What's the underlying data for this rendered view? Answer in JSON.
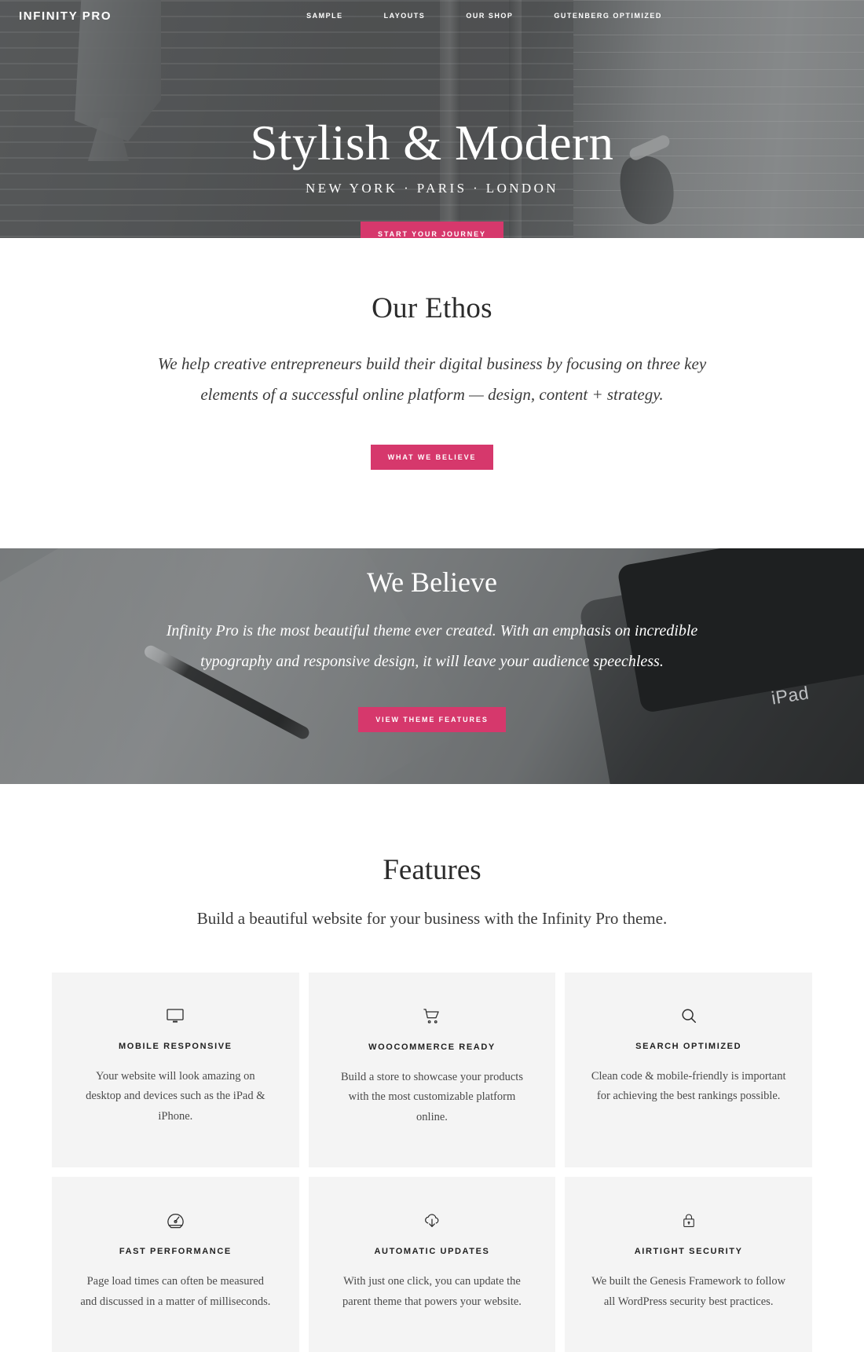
{
  "colors": {
    "accent": "#d6386c",
    "card_bg": "#f4f4f4",
    "hero_overlay": "#5f6163",
    "text_dark": "#2b2b2b"
  },
  "header": {
    "site_title": "INFINITY PRO",
    "nav": [
      {
        "label": "SAMPLE"
      },
      {
        "label": "LAYOUTS"
      },
      {
        "label": "OUR SHOP"
      },
      {
        "label": "GUTENBERG OPTIMIZED"
      }
    ]
  },
  "hero": {
    "title": "Stylish & Modern",
    "subtitle": "NEW YORK · PARIS · LONDON",
    "cta_label": "START YOUR JOURNEY"
  },
  "ethos": {
    "title": "Our Ethos",
    "text": "We help creative entrepreneurs build their digital business by focusing on three key elements of a successful online platform — design, content + strategy.",
    "cta_label": "WHAT WE BELIEVE"
  },
  "believe": {
    "title": "We Believe",
    "text": "Infinity Pro is the most beautiful theme ever created. With an emphasis on incredible typography and responsive design, it will leave your audience speechless.",
    "cta_label": "VIEW THEME FEATURES",
    "device_label": "iPad"
  },
  "features": {
    "title": "Features",
    "subtitle": "Build a beautiful website for your business with the Infinity Pro theme.",
    "cards": [
      {
        "icon": "monitor-icon",
        "title": "MOBILE RESPONSIVE",
        "text": "Your website will look amazing on desktop and devices such as the iPad & iPhone."
      },
      {
        "icon": "shopping-cart-icon",
        "title": "WOOCOMMERCE READY",
        "text": "Build a store to showcase your products with the most customizable platform online."
      },
      {
        "icon": "search-icon",
        "title": "SEARCH OPTIMIZED",
        "text": "Clean code & mobile-friendly is important for achieving the best rankings possible."
      },
      {
        "icon": "speedometer-icon",
        "title": "FAST PERFORMANCE",
        "text": "Page load times can often be measured and discussed in a matter of milliseconds."
      },
      {
        "icon": "cloud-download-icon",
        "title": "AUTOMATIC UPDATES",
        "text": "With just one click, you can update the parent theme that powers your website."
      },
      {
        "icon": "lock-icon",
        "title": "AIRTIGHT SECURITY",
        "text": "We built the Genesis Framework to follow all WordPress security best practices."
      }
    ]
  }
}
